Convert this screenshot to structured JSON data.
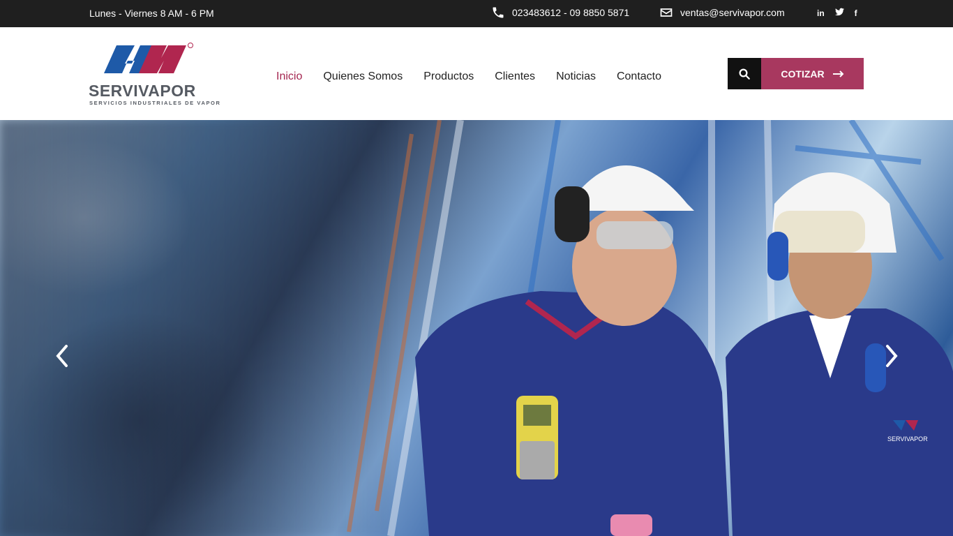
{
  "topbar": {
    "hours": "Lunes - Viernes 8 AM - 6 PM",
    "phone": "023483612 - 09 8850 5871",
    "email": "ventas@servivapor.com",
    "social": [
      {
        "icon": "linkedin-icon",
        "label": "in"
      },
      {
        "icon": "twitter-icon",
        "label": "t"
      },
      {
        "icon": "facebook-icon",
        "label": "f"
      }
    ]
  },
  "header": {
    "logo": {
      "brand": "SERVIVAPOR",
      "tagline": "SERVICIOS INDUSTRIALES DE VAPOR",
      "colors": {
        "blue": "#1e5aa8",
        "red": "#b0264f",
        "gray": "#555a62"
      }
    },
    "nav": [
      {
        "label": "Inicio",
        "active": true
      },
      {
        "label": "Quienes Somos",
        "active": false
      },
      {
        "label": "Productos",
        "active": false
      },
      {
        "label": "Clientes",
        "active": false
      },
      {
        "label": "Noticias",
        "active": false
      },
      {
        "label": "Contacto",
        "active": false
      }
    ],
    "cotizar_label": "COTIZAR",
    "accent": "#a8385f"
  },
  "hero": {
    "badge_brand": "SERVIVAPOR"
  }
}
